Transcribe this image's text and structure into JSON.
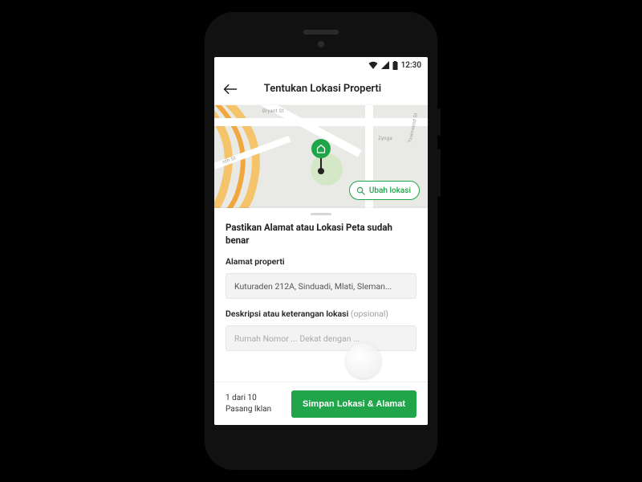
{
  "status": {
    "time": "12:30"
  },
  "header": {
    "title": "Tentukan Lokasi Properti"
  },
  "map": {
    "labels": {
      "bryant": "Bryant St",
      "townsend": "Townsend St",
      "nth": "nth St",
      "zynga": "Zynga"
    },
    "change_location_label": "Ubah lokasi"
  },
  "sheet": {
    "heading": "Pastikan Alamat atau Lokasi Peta sudah benar",
    "address_label": "Alamat properti",
    "address_value": "Kuturaden 212A, Sinduadi, Mlati, Sleman...",
    "desc_label": "Deskripsi atau keterangan lokasi",
    "desc_optional": "(opsional)",
    "desc_placeholder": "Rumah Nomor ... Dekat dengan ..."
  },
  "footer": {
    "progress_line1": "1 dari 10",
    "progress_line2": "Pasang Iklan",
    "cta_label": "Simpan Lokasi & Alamat"
  }
}
